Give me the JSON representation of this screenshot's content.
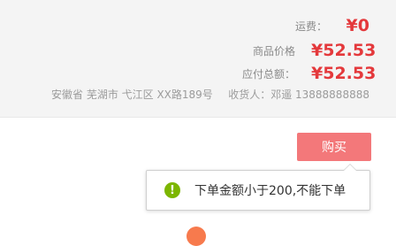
{
  "summary": {
    "shipping_label": "运费：",
    "shipping_value": "¥0",
    "price_label": "商品价格",
    "price_value": "¥52.53",
    "total_label": "应付总额：",
    "total_value": "¥52.53"
  },
  "address": {
    "text": "安徽省 芜湖市 弋江区 XX路189号",
    "receiver": "收货人：邓遥 13888888888"
  },
  "actions": {
    "buy_label": "购买"
  },
  "tooltip": {
    "icon": "!",
    "message": "下单金额小于200,不能下单"
  },
  "colors": {
    "price_red": "#e4393c",
    "buy_button": "#f3787a",
    "warning_icon": "#7cb600"
  }
}
